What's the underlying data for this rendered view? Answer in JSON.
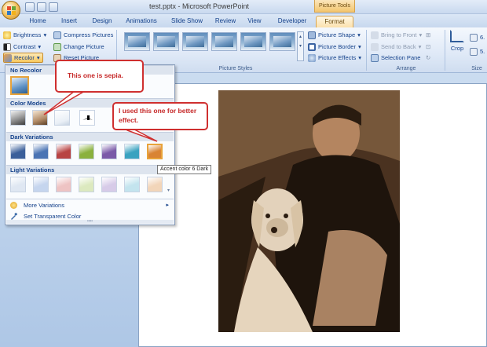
{
  "window": {
    "title": "test.pptx - Microsoft PowerPoint",
    "context_tools": "Picture Tools"
  },
  "tabs": [
    "Home",
    "Insert",
    "Design",
    "Animations",
    "Slide Show",
    "Review",
    "View",
    "Developer",
    "Format"
  ],
  "ribbon": {
    "adjust": {
      "brightness": "Brightness",
      "contrast": "Contrast",
      "recolor": "Recolor",
      "compress": "Compress Pictures",
      "change": "Change Picture",
      "reset": "Reset Picture"
    },
    "picture_styles": {
      "label": "Picture Styles",
      "shape": "Picture Shape",
      "border": "Picture Border",
      "effects": "Picture Effects"
    },
    "arrange": {
      "label": "Arrange",
      "front": "Bring to Front",
      "back": "Send to Back",
      "pane": "Selection Pane"
    },
    "size": {
      "label": "Size",
      "crop": "Crop",
      "height_value": "6.",
      "width_value": "5."
    }
  },
  "recolor_menu": {
    "sections": {
      "no_recolor": "No Recolor",
      "color_modes": "Color Modes",
      "dark": "Dark Variations",
      "light": "Light Variations"
    },
    "more_variations": "More Variations",
    "set_transparent": "Set Transparent Color",
    "colors": {
      "dark": [
        "#3a5f9a",
        "#4a74b4",
        "#b84343",
        "#8bb13e",
        "#7a5aa8",
        "#3aa2c0",
        "#d98434"
      ],
      "light": [
        "#dfe7f2",
        "#c5d5ee",
        "#eec3c3",
        "#dce9bf",
        "#d7cbe8",
        "#c3e4ee",
        "#f2d5b9"
      ]
    }
  },
  "tooltip": "Accent color 6 Dark",
  "callouts": {
    "sepia": "This one is sepia.",
    "effect": "I used this one for better effect."
  }
}
